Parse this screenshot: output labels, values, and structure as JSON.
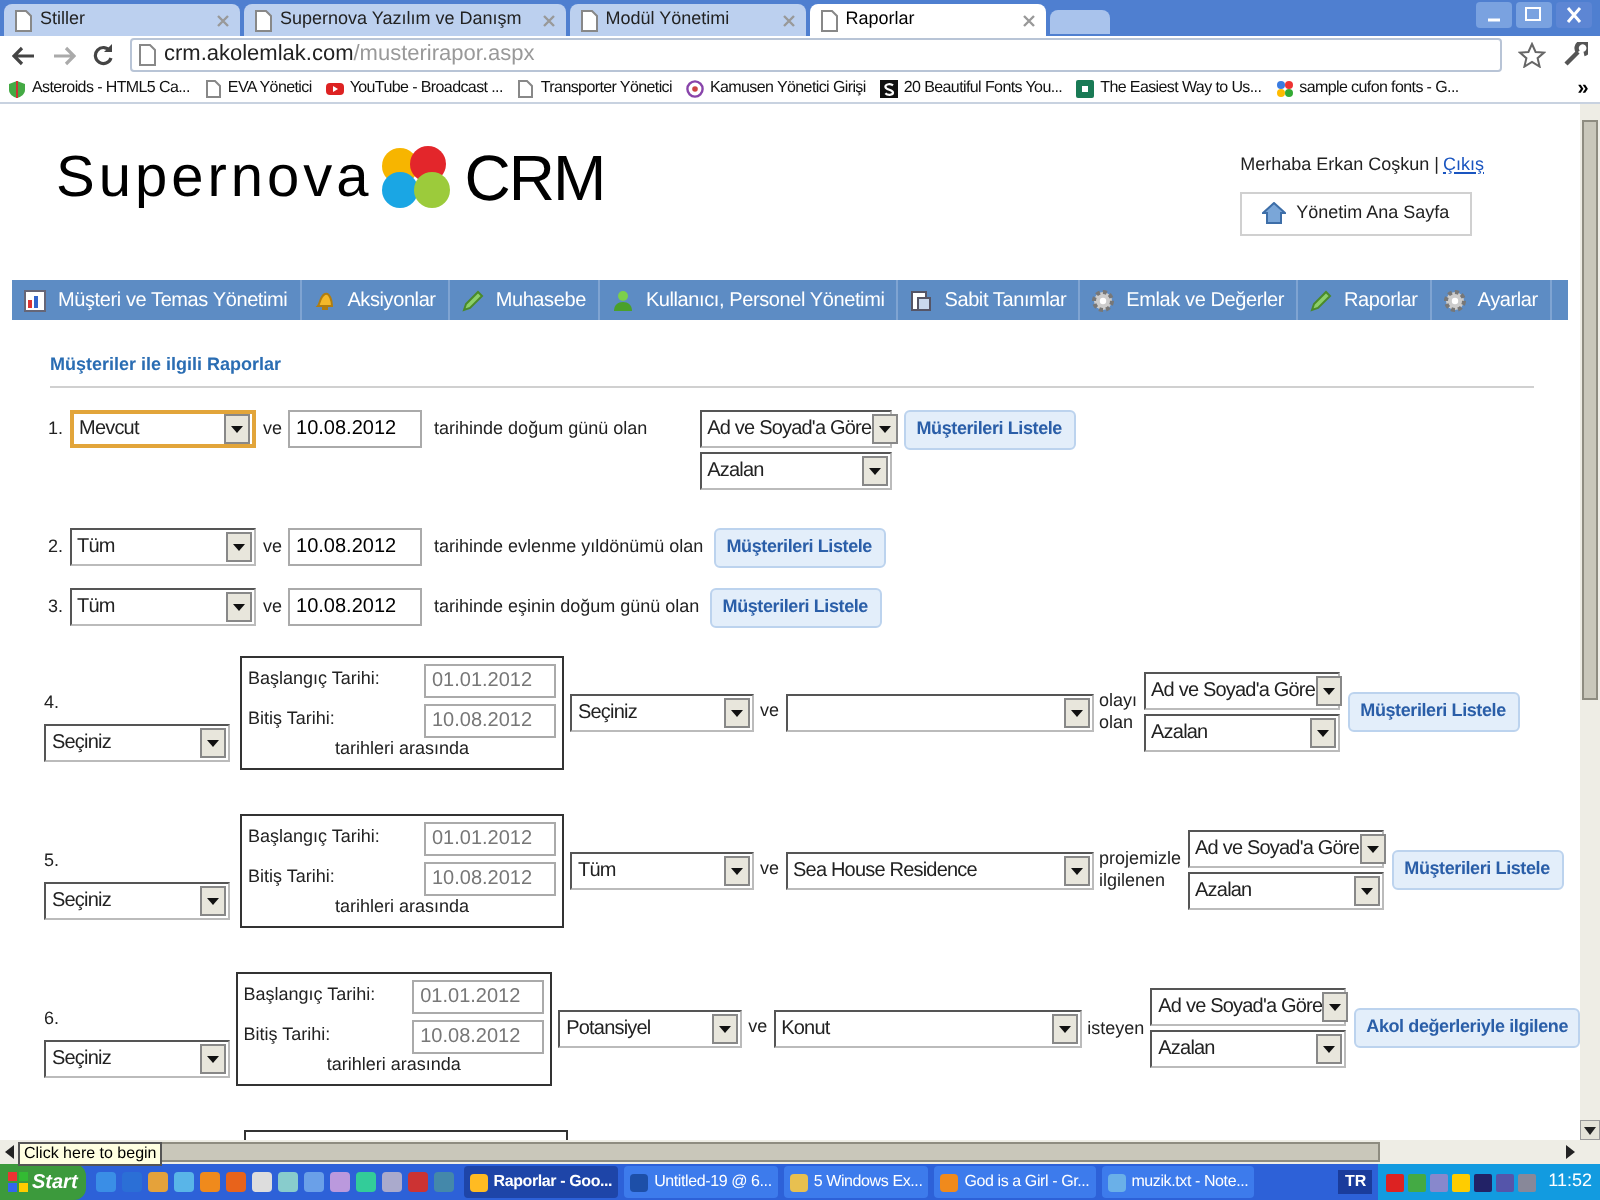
{
  "browser": {
    "tabs": [
      {
        "label": "Stiller",
        "selected": false
      },
      {
        "label": "Supernova Yazılım ve Danışm",
        "selected": false
      },
      {
        "label": "Modül Yönetimi",
        "selected": false
      },
      {
        "label": "Raporlar",
        "selected": true
      }
    ],
    "address": {
      "host": "crm.akolemlak.com",
      "path": "/musterirapor.aspx"
    },
    "bookmarks": [
      {
        "label": "Asteroids - HTML5 Ca...",
        "kind": "shield"
      },
      {
        "label": "EVA Yönetici",
        "kind": "page"
      },
      {
        "label": "YouTube - Broadcast ...",
        "kind": "play"
      },
      {
        "label": "Transporter Yönetici",
        "kind": "page"
      },
      {
        "label": "Kamusen Yönetici Girişi",
        "kind": "ring"
      },
      {
        "label": "20 Beautiful Fonts You...",
        "kind": "letter"
      },
      {
        "label": "The Easiest Way to Us...",
        "kind": "square"
      },
      {
        "label": "sample cufon fonts - G...",
        "kind": "dots"
      }
    ],
    "bookmarks_more": "»"
  },
  "header": {
    "logo_left": "Supernova",
    "logo_right": "CRM",
    "greeting": "Merhaba Erkan Coşkun |",
    "logout": "Çıkış",
    "home_button": "Yönetim Ana Sayfa"
  },
  "nav": [
    "Müşteri ve Temas Yönetimi",
    "Aksiyonlar",
    "Muhasebe",
    "Kullanıcı, Personel Yönetimi",
    "Sabit Tanımlar",
    "Emlak ve Değerler",
    "Raporlar",
    "Ayarlar"
  ],
  "section_title": "Müşteriler ile ilgili Raporlar",
  "simple_reports": [
    {
      "number": "1.",
      "filter": "Mevcut",
      "focused": true,
      "connector": "ve",
      "date": "10.08.2012",
      "description": "tarihinde doğum günü olan",
      "sort_field": "Ad ve Soyad'a Göre",
      "sort_order": "Azalan",
      "button": "Müşterileri Listele"
    },
    {
      "number": "2.",
      "filter": "Tüm",
      "focused": false,
      "connector": "ve",
      "date": "10.08.2012",
      "description": "tarihinde evlenme yıldönümü olan",
      "button": "Müşterileri Listele"
    },
    {
      "number": "3.",
      "filter": "Tüm",
      "focused": false,
      "connector": "ve",
      "date": "10.08.2012",
      "description": "tarihinde eşinin doğum günü olan",
      "button": "Müşterileri Listele"
    }
  ],
  "range_reports": [
    {
      "number": "4.",
      "filter": "Seçiniz",
      "start_label": "Başlangıç Tarihi:",
      "start": {
        "value": "01.01.2012",
        "disabled": true
      },
      "end_label": "Bitiş Tarihi:",
      "end": {
        "value": "10.08.2012",
        "disabled": true
      },
      "range_note": "tarihleri arasında",
      "type": "Seçiniz",
      "connector": "ve",
      "relation": "olayı olan",
      "sort_field": "Ad ve Soyad'a Göre",
      "sort_order": "Azalan",
      "button": "Müşterileri Listele"
    },
    {
      "number": "5.",
      "filter": "Seçiniz",
      "start_label": "Başlangıç Tarihi:",
      "start": {
        "value": "01.01.2012",
        "disabled": true
      },
      "end_label": "Bitiş Tarihi:",
      "end": {
        "value": "10.08.2012",
        "disabled": true
      },
      "range_note": "tarihleri arasında",
      "type": "Tüm",
      "connector": "ve",
      "detail": "Sea House Residence",
      "relation": "projemizle ilgilenen",
      "sort_field": "Ad ve Soyad'a Göre",
      "sort_order": "Azalan",
      "button": "Müşterileri Listele"
    },
    {
      "number": "6.",
      "filter": "Seçiniz",
      "start_label": "Başlangıç Tarihi:",
      "start": {
        "value": "01.01.2012",
        "disabled": true
      },
      "end_label": "Bitiş Tarihi:",
      "end": {
        "value": "10.08.2012",
        "disabled": true
      },
      "range_note": "tarihleri arasında",
      "type": "Potansiyel",
      "connector": "ve",
      "detail": "Konut",
      "relation": "isteyen",
      "sort_field": "Ad ve Soyad'a Göre",
      "sort_order": "Azalan",
      "button": "Akol değerleriyle ilgilene"
    }
  ],
  "taskbar": {
    "start": "Start",
    "tooltip": "Click here to begin",
    "tasks": [
      {
        "label": "Raporlar - Goo...",
        "selected": true
      },
      {
        "label": "Untitled-19 @ 6...",
        "selected": false
      },
      {
        "label": "5 Windows Ex...",
        "selected": false
      },
      {
        "label": "God is a Girl - Gr...",
        "selected": false
      },
      {
        "label": "muzik.txt - Note...",
        "selected": false
      }
    ],
    "language": "TR",
    "clock": "11:52"
  }
}
